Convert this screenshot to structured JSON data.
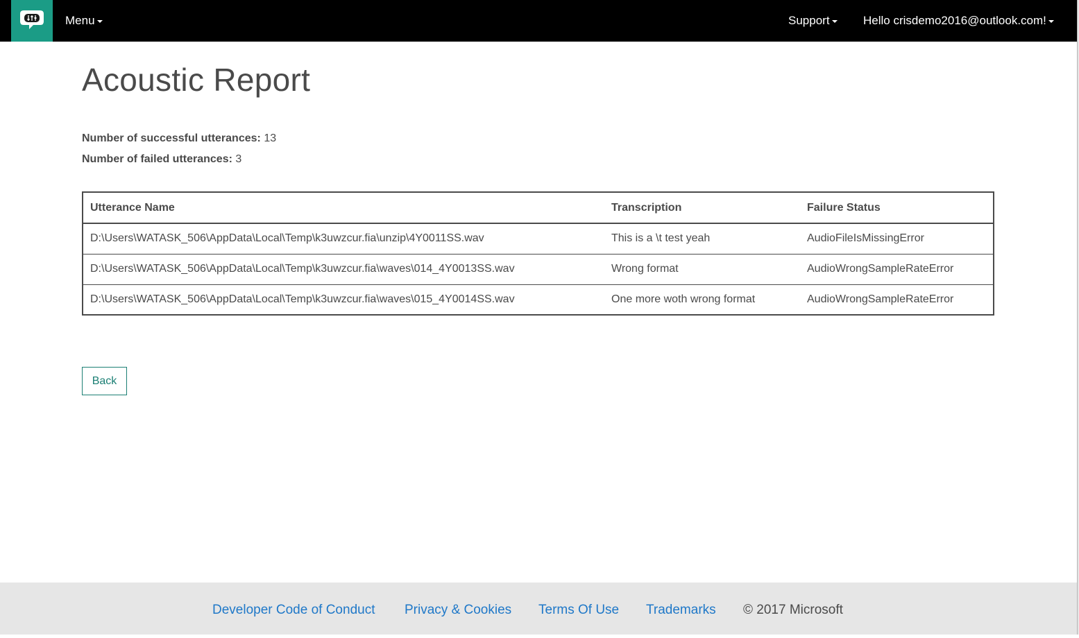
{
  "navbar": {
    "logo_icon": "speech-bubble-equalizer-icon",
    "menu_label": "Menu",
    "support_label": "Support",
    "user_label": "Hello crisdemo2016@outlook.com!",
    "background": "#000000",
    "logo_color": "#1b9c86"
  },
  "main": {
    "title": "Acoustic Report",
    "successful_label": "Number of successful utterances:",
    "successful_value": "13",
    "failed_label": "Number of failed utterances:",
    "failed_value": "3"
  },
  "table": {
    "headers": [
      "Utterance Name",
      "Transcription",
      "Failure Status"
    ],
    "rows": [
      [
        "D:\\Users\\WATASK_506\\AppData\\Local\\Temp\\k3uwzcur.fia\\unzip\\4Y0011SS.wav",
        "This is a \\t test yeah",
        "AudioFileIsMissingError"
      ],
      [
        "D:\\Users\\WATASK_506\\AppData\\Local\\Temp\\k3uwzcur.fia\\waves\\014_4Y0013SS.wav",
        "Wrong format",
        "AudioWrongSampleRateError"
      ],
      [
        "D:\\Users\\WATASK_506\\AppData\\Local\\Temp\\k3uwzcur.fia\\waves\\015_4Y0014SS.wav",
        "One more woth wrong format",
        "AudioWrongSampleRateError"
      ]
    ]
  },
  "back_label": "Back",
  "footer": {
    "links": [
      "Developer Code of Conduct",
      "Privacy & Cookies",
      "Terms Of Use",
      "Trademarks"
    ],
    "copyright": "© 2017 Microsoft",
    "link_color": "#1f78c8"
  }
}
